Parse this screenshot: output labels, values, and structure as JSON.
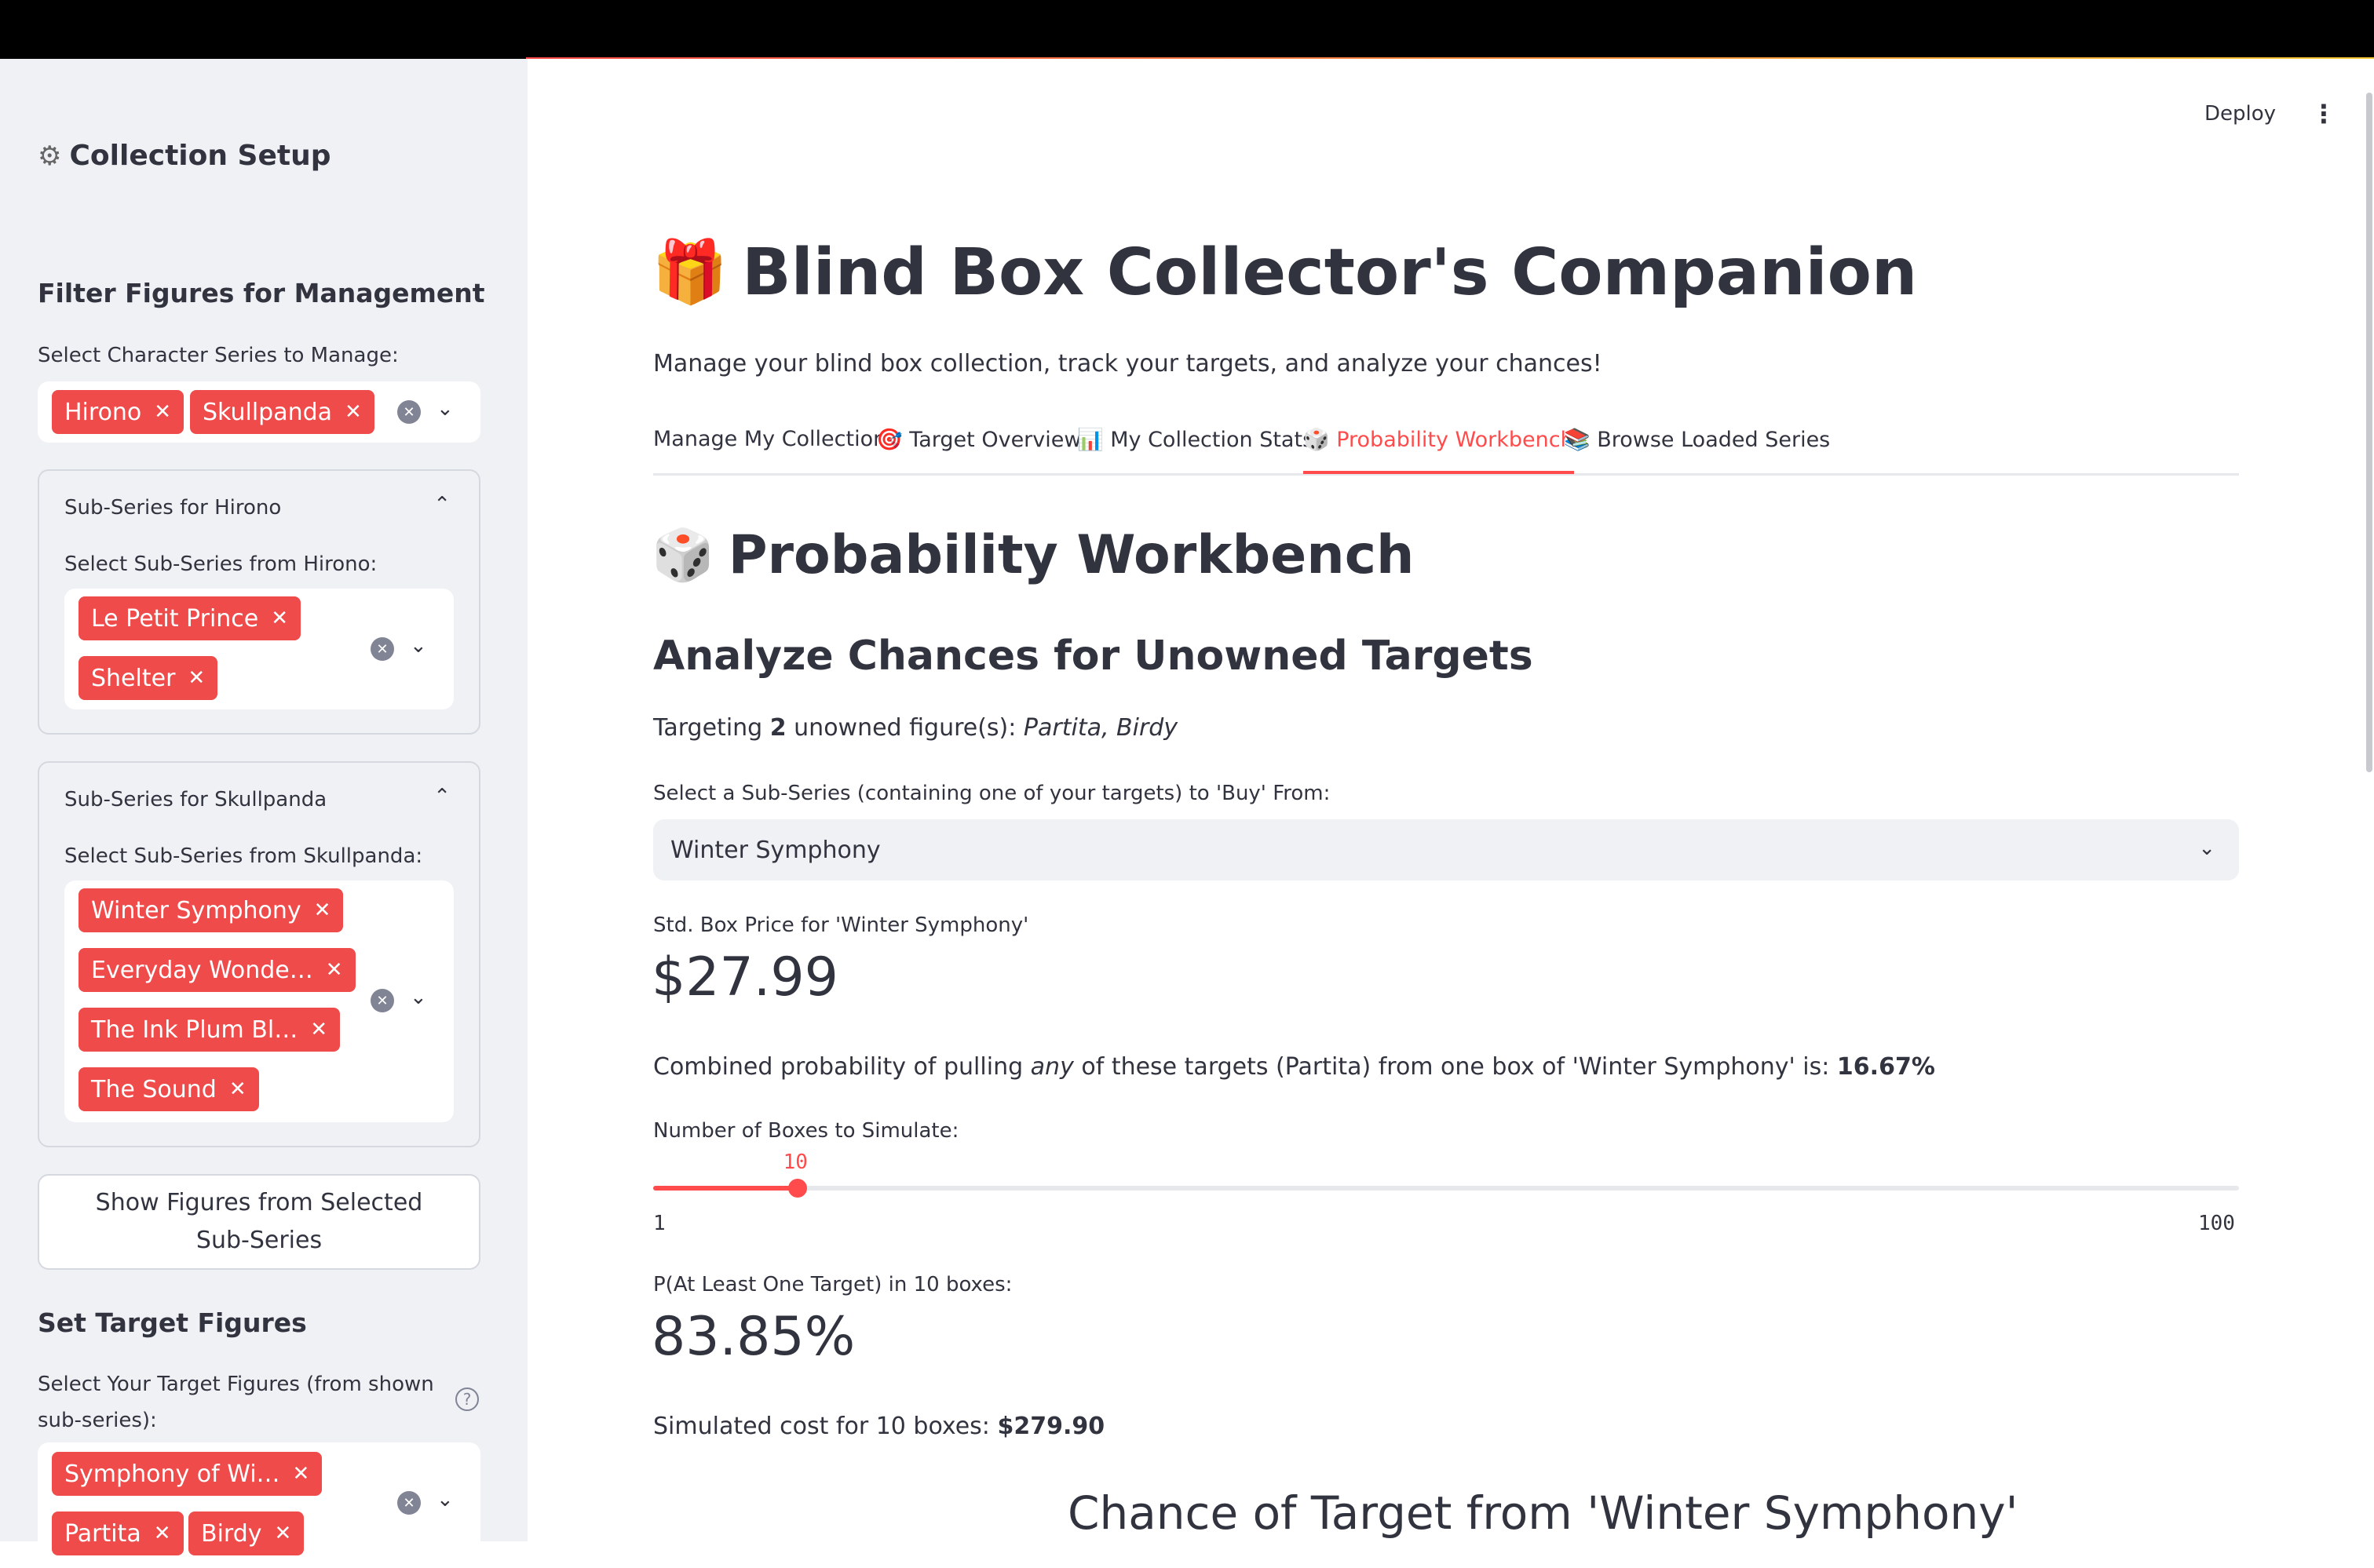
{
  "sidebar": {
    "setup_icon": "⚙",
    "setup_title": "Collection Setup",
    "filter_heading": "Filter Figures for Management",
    "series_label": "Select Character Series to Manage:",
    "series_selected": [
      "Hirono",
      "Skullpanda"
    ],
    "expanders": [
      {
        "title": "Sub-Series for Hirono",
        "label": "Select Sub-Series from Hirono:",
        "selected": [
          "Le Petit Prince",
          "Shelter"
        ]
      },
      {
        "title": "Sub-Series for Skullpanda",
        "label": "Select Sub-Series from Skullpanda:",
        "selected": [
          "Winter Symphony",
          "Everyday Wonde…",
          "The Ink Plum Bl…",
          "The Sound"
        ]
      }
    ],
    "show_button": "Show Figures from Selected Sub-Series",
    "target_heading": "Set Target Figures",
    "target_label": "Select Your Target Figures (from shown sub-series):",
    "target_selected": [
      "Symphony of Wi…",
      "Partita",
      "Birdy"
    ]
  },
  "header": {
    "deploy": "Deploy",
    "menu_icon": "⋮"
  },
  "main": {
    "title_icon": "🎁",
    "title": "Blind Box Collector's Companion",
    "subtitle": "Manage your blind box collection, track your targets, and analyze your chances!",
    "tabs": [
      {
        "icon": "",
        "label": "Manage My Collection"
      },
      {
        "icon": "🎯",
        "label": "Target Overview"
      },
      {
        "icon": "📊",
        "label": "My Collection Stats"
      },
      {
        "icon": "🎲",
        "label": "Probability Workbench"
      },
      {
        "icon": "📚",
        "label": "Browse Loaded Series"
      }
    ],
    "active_tab": "Probability Workbench",
    "workbench_icon": "🎲",
    "workbench_title": "Probability Workbench",
    "analyze_heading": "Analyze Chances for Unowned Targets",
    "targeting_prefix": "Targeting ",
    "targeting_count": "2",
    "targeting_middle": " unowned figure(s): ",
    "targeting_names": "Partita, Birdy",
    "select_label": "Select a Sub-Series (containing one of your targets) to 'Buy' From:",
    "select_value": "Winter Symphony",
    "price_label": "Std. Box Price for 'Winter Symphony'",
    "price_value": "$27.99",
    "combined_prefix": "Combined probability of pulling ",
    "combined_em": "any",
    "combined_middle": " of these targets (Partita) from one box of 'Winter Symphony' is: ",
    "combined_value": "16.67%",
    "slider_label": "Number of Boxes to Simulate:",
    "slider_value": 10,
    "slider_value_text": "10",
    "slider_min": "1",
    "slider_max": "100",
    "prob_label": "P(At Least One Target) in 10 boxes:",
    "prob_value": "83.85%",
    "cost_prefix": "Simulated cost for 10 boxes: ",
    "cost_value": "$279.90",
    "chart_title": "Chance of Target from 'Winter Symphony'"
  }
}
